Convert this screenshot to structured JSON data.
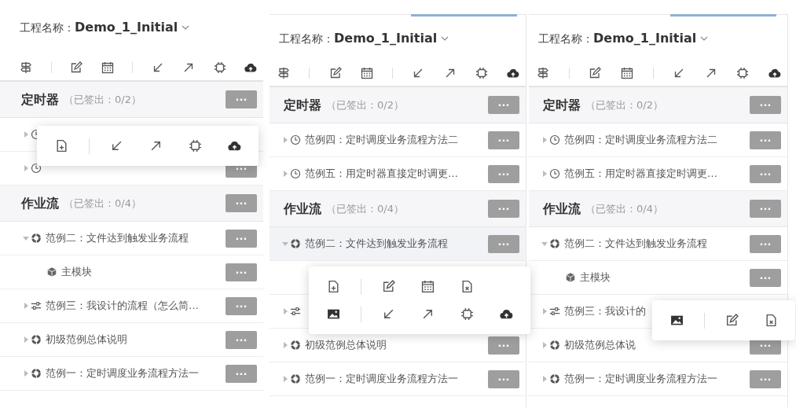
{
  "panels": [
    {
      "project_label": "工程名称：",
      "project_name": "Demo_1_Initial",
      "groups": [
        {
          "title": "定时器",
          "note": "（已签出：0/2）",
          "action": "···",
          "rows": [
            {
              "kind": "timer",
              "expanded": false,
              "selected": false
            },
            {
              "kind": "timer",
              "expanded": false,
              "selected": false,
              "action": "···"
            }
          ]
        },
        {
          "title": "作业流",
          "note": "（已签出：0/4）",
          "action": "···",
          "rows": [
            {
              "kind": "workflow",
              "label": "范例二：文件达到触发业务流程",
              "expanded": true,
              "selected": false,
              "action": "···",
              "children": [
                {
                  "kind": "module",
                  "label": "主模块",
                  "selected": false,
                  "action": "···"
                }
              ]
            },
            {
              "kind": "custom",
              "label": "范例三：我设计的流程（怎么简…",
              "expanded": false,
              "selected": false,
              "action": "···"
            },
            {
              "kind": "workflow",
              "label": "初级范例总体说明",
              "expanded": false,
              "selected": false,
              "action": "···"
            },
            {
              "kind": "workflow",
              "label": "范例一：定时调度业务流程方法一",
              "expanded": false,
              "selected": false,
              "action": "···"
            }
          ]
        }
      ]
    },
    {
      "tab_indicator": true,
      "project_label": "工程名称：",
      "project_name": "Demo_1_Initial",
      "groups": [
        {
          "title": "定时器",
          "note": "（已签出：0/2）",
          "action": "···",
          "rows": [
            {
              "kind": "timer",
              "label": "范例四：定时调度业务流程方法二",
              "expanded": false,
              "selected": false,
              "action": "···"
            },
            {
              "kind": "timer",
              "label": "范例五：用定时器直接定时调更…",
              "expanded": false,
              "selected": false,
              "action": "···"
            }
          ]
        },
        {
          "title": "作业流",
          "note": "（已签出：0/4）",
          "action": "···",
          "rows": [
            {
              "kind": "workflow",
              "label": "范例二：文件达到触发业务流程",
              "expanded": true,
              "selected": true,
              "action": "···",
              "children": [
                {
                  "selected": false
                }
              ]
            },
            {
              "kind": "custom",
              "expanded": false,
              "selected": false
            },
            {
              "kind": "workflow",
              "label": "初级范例总体说明",
              "expanded": false,
              "selected": false,
              "action": "···"
            },
            {
              "kind": "workflow",
              "label": "范例一：定时调度业务流程方法一",
              "expanded": false,
              "selected": false,
              "action": "···"
            }
          ]
        }
      ]
    },
    {
      "tab_indicator": true,
      "project_label": "工程名称：",
      "project_name": "Demo_1_Initial",
      "groups": [
        {
          "title": "定时器",
          "note": "（已签出：0/2）",
          "action": "···",
          "rows": [
            {
              "kind": "timer",
              "label": "范例四：定时调度业务流程方法二",
              "expanded": false,
              "selected": false,
              "action": "···"
            },
            {
              "kind": "timer",
              "label": "范例五：用定时器直接定时调更…",
              "expanded": false,
              "selected": false,
              "action": "···"
            }
          ]
        },
        {
          "title": "作业流",
          "note": "（已签出：0/4）",
          "action": "···",
          "rows": [
            {
              "kind": "workflow",
              "label": "范例二：文件达到触发业务流程",
              "expanded": true,
              "selected": false,
              "action": "···",
              "children": [
                {
                  "kind": "module",
                  "label": "主模块",
                  "selected": false,
                  "action": "···"
                }
              ]
            },
            {
              "kind": "custom",
              "label": "范例三：我设计的",
              "expanded": false,
              "selected": false
            },
            {
              "kind": "workflow",
              "label": "初级范例总体说",
              "expanded": false,
              "selected": false,
              "action": "···"
            },
            {
              "kind": "workflow",
              "label": "范例一：定时调度业务流程方法一",
              "expanded": false,
              "selected": false,
              "action": "···"
            }
          ]
        }
      ]
    }
  ]
}
